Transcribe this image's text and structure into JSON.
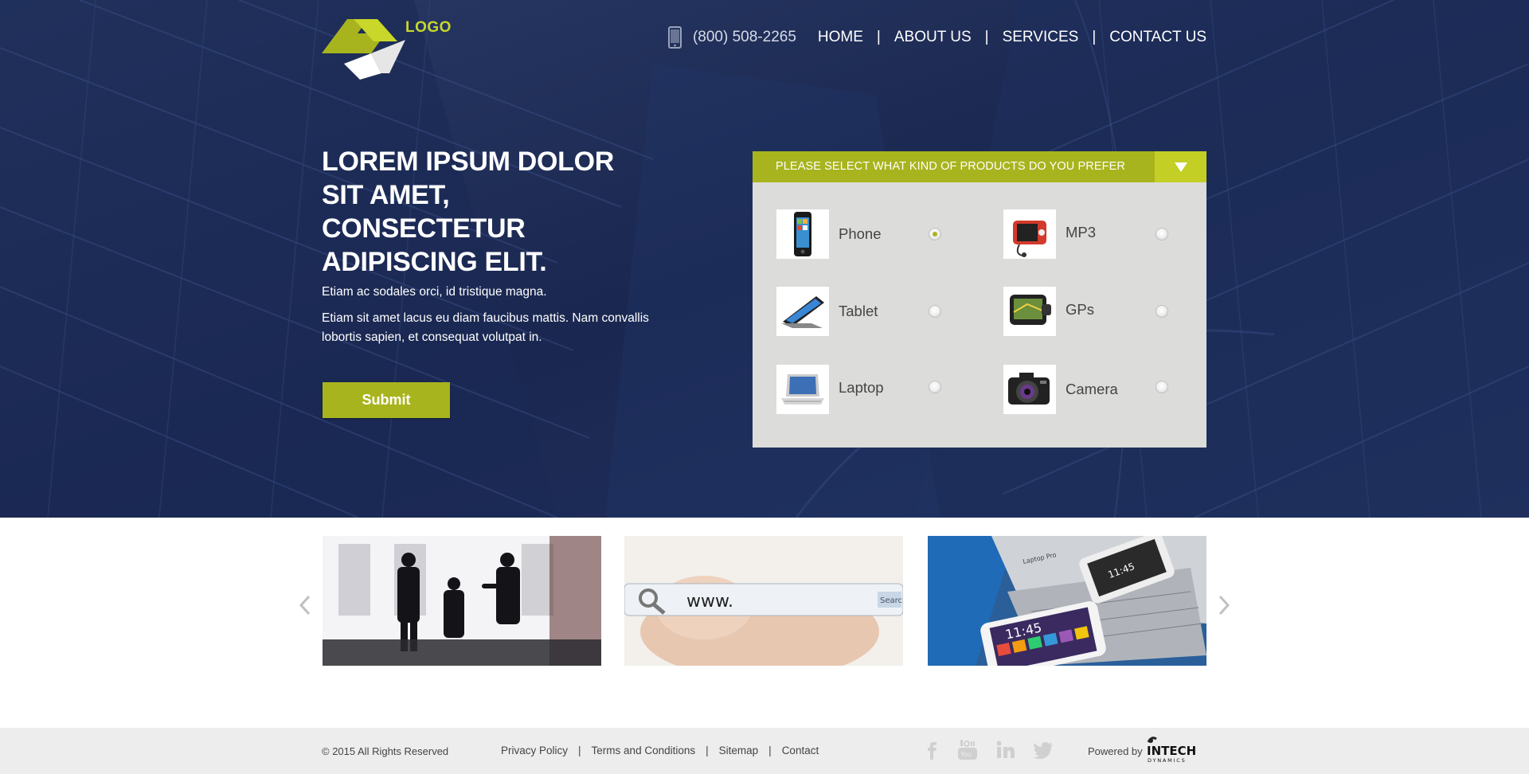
{
  "header": {
    "logo_text": "LOGO",
    "phone": "(800) 508-2265",
    "nav": [
      {
        "label": "HOME"
      },
      {
        "label": "ABOUT US"
      },
      {
        "label": "SERVICES"
      },
      {
        "label": "CONTACT US"
      }
    ],
    "nav_separator": "|"
  },
  "hero": {
    "title": "LOREM IPSUM DOLOR SIT AMET, CONSECTETUR ADIPISCING ELIT.",
    "text1": "Etiam ac sodales orci, id tristique magna.",
    "text2": "Etiam sit amet lacus eu diam faucibus mattis. Nam convallis lobortis sapien, et consequat volutpat in.",
    "submit_label": "Submit"
  },
  "product_panel": {
    "heading": "PLEASE SELECT WHAT KIND OF PRODUCTS DO YOU PREFER",
    "products": [
      {
        "label": "Phone",
        "icon": "phone-product-icon",
        "selected": true
      },
      {
        "label": "MP3",
        "icon": "mp3-player-icon",
        "selected": false
      },
      {
        "label": "Tablet",
        "icon": "tablet-icon",
        "selected": false
      },
      {
        "label": "GPs",
        "icon": "gps-device-icon",
        "selected": false
      },
      {
        "label": "Laptop",
        "icon": "laptop-icon",
        "selected": false
      },
      {
        "label": "Camera",
        "icon": "camera-icon",
        "selected": false
      }
    ]
  },
  "carousel": {
    "slides": [
      {
        "name": "business-people-image"
      },
      {
        "name": "search-bar-image",
        "url_text": "www.",
        "search_button": "Search"
      },
      {
        "name": "devices-image",
        "clock_small": "11:45",
        "clock_large": "11:45",
        "laptop_brand": "Laptop Pro"
      }
    ]
  },
  "footer": {
    "copyright": "© 2015 All Rights Reserved",
    "links": [
      {
        "label": "Privacy Policy"
      },
      {
        "label": "Terms and Conditions"
      },
      {
        "label": "Sitemap"
      },
      {
        "label": "Contact"
      }
    ],
    "link_separator": "|",
    "social": [
      "facebook-icon",
      "youtube-icon",
      "linkedin-icon",
      "twitter-icon"
    ],
    "powered_by": "Powered  by",
    "brand_name": "INTECH",
    "brand_sub": "DYNAMICS"
  },
  "colors": {
    "accent": "#a8b41d",
    "accent_light": "#c8d72a",
    "hero_bg": "#1d2a52",
    "panel_bg": "#dcdcda",
    "footer_bg": "#ededed"
  }
}
